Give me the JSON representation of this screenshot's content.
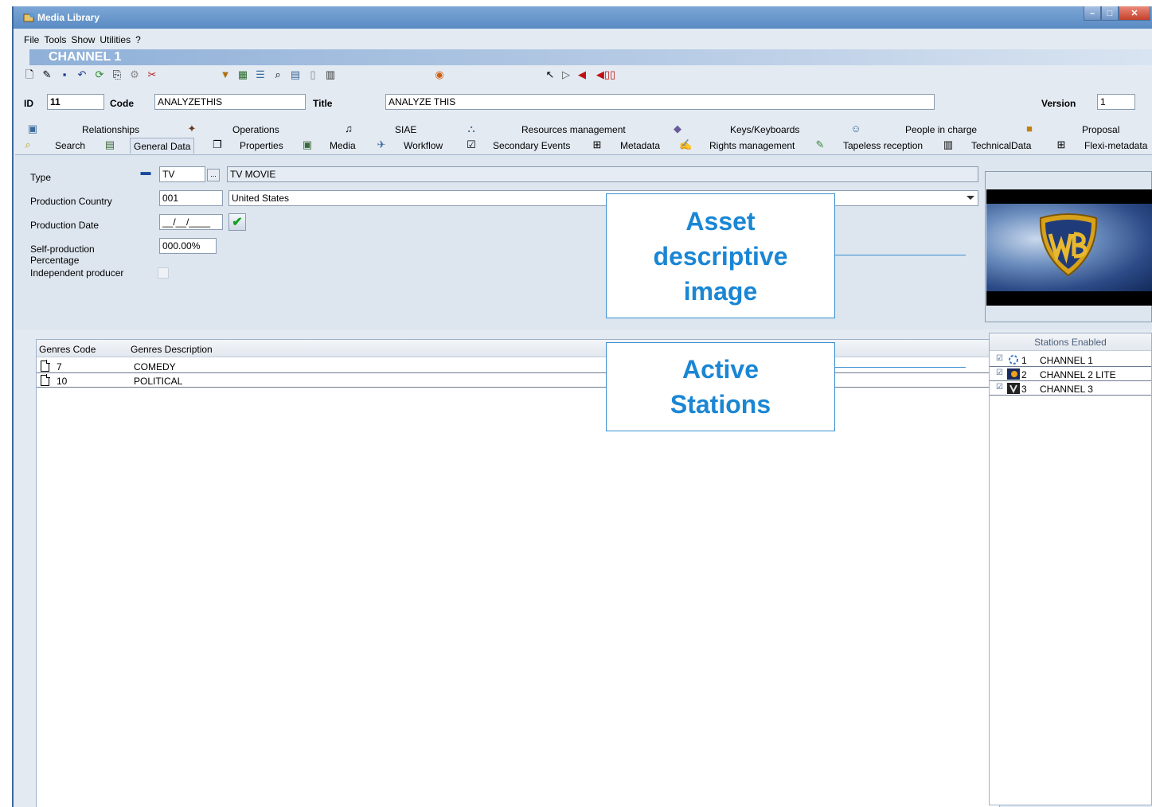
{
  "window": {
    "title": "Media Library",
    "controls": [
      "–",
      "□",
      "✕"
    ]
  },
  "menu": [
    "File",
    "Tools",
    "Show",
    "Utilities",
    "?"
  ],
  "channel_header": "CHANNEL 1",
  "id_row": {
    "id_label": "ID",
    "id_value": "11",
    "code_label": "Code",
    "code_value": "ANALYZETHIS",
    "title_label": "Title",
    "title_value": "ANALYZE THIS",
    "version_label": "Version",
    "version_value": "1"
  },
  "tabs_top": [
    "Relationships",
    "Operations",
    "SIAE",
    "Resources management",
    "Keys/Keyboards",
    "People in charge",
    "Proposal"
  ],
  "tabs_bottom": [
    "Search",
    "General Data",
    "Properties",
    "Media",
    "Workflow",
    "Secondary Events",
    "Metadata",
    "Rights management",
    "Tapeless reception",
    "TechnicalData",
    "Flexi-metadata"
  ],
  "general": {
    "type_label": "Type",
    "type_code": "TV",
    "type_browse": "...",
    "type_desc": "TV MOVIE",
    "country_label": "Production Country",
    "country_code": "001",
    "country_name": "United States",
    "date_label": "Production Date",
    "date_value": "__/__/____",
    "selfprod_label_1": "Self-production",
    "selfprod_label_2": "Percentage",
    "selfprod_value": "000.00%",
    "indep_label": "Independent producer"
  },
  "callouts": {
    "image_1": "Asset",
    "image_2": "descriptive",
    "image_3": "image",
    "stations_1": "Active",
    "stations_2": "Stations"
  },
  "genres": {
    "headers": [
      "Genres Code",
      "Genres Description"
    ],
    "rows": [
      {
        "code": "7",
        "desc": "COMEDY"
      },
      {
        "code": "10",
        "desc": "POLITICAL"
      }
    ]
  },
  "stations": {
    "header": "Stations Enabled",
    "rows": [
      {
        "num": "1",
        "name": "CHANNEL 1"
      },
      {
        "num": "2",
        "name": "CHANNEL 2 LITE"
      },
      {
        "num": "3",
        "name": "CHANNEL 3"
      }
    ]
  },
  "colors": {
    "accent": "#1a86d4",
    "window_title": "#5a8bc4",
    "panel": "#dde6ef"
  }
}
